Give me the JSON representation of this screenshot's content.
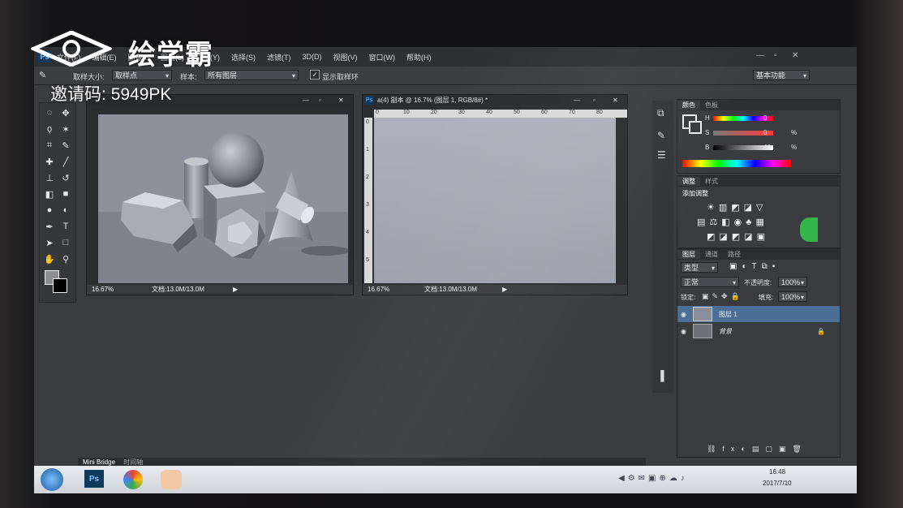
{
  "watermark": {
    "brand": "绘学霸",
    "invite_label": "邀请码:",
    "invite_code": "5949PK"
  },
  "menubar": {
    "app_icon": "Ps",
    "items": [
      "文件(F)",
      "编辑(E)",
      "图像(I)",
      "图层(L)",
      "文字(Y)",
      "选择(S)",
      "滤镜(T)",
      "3D(D)",
      "视图(V)",
      "窗口(W)",
      "帮助(H)"
    ],
    "window_controls": [
      "—",
      "▫",
      "✕"
    ]
  },
  "options_bar": {
    "sample_size_label": "取样大小:",
    "sample_size_value": "取样点",
    "sample_label": "样本:",
    "sample_value": "所有图层",
    "show_ring_label": "显示取样环",
    "show_ring_checked": true,
    "workspace_value": "基本功能"
  },
  "doc1": {
    "zoom": "16.67%",
    "doc_size": "文档:13.0M/13.0M",
    "controls": [
      "—",
      "▫",
      "✕"
    ]
  },
  "doc2": {
    "title": "a(4) 副本 @ 16.7% (图层 1, RGB/8#) *",
    "zoom": "16.67%",
    "doc_size": "文档:13.0M/13.0M",
    "ruler_h": [
      "0",
      "10",
      "20",
      "30",
      "40",
      "50",
      "60",
      "70",
      "80"
    ],
    "ruler_v": [
      "0",
      "1",
      "2",
      "3",
      "4",
      "5"
    ],
    "controls": [
      "—",
      "▫",
      "✕"
    ]
  },
  "color_panel": {
    "tabs": [
      "颜色",
      "色板"
    ],
    "rows": [
      {
        "label": "H",
        "value": "0",
        "unit": "",
        "fraction": 0.0
      },
      {
        "label": "S",
        "value": "0",
        "unit": "%",
        "fraction": 0.0
      },
      {
        "label": "B",
        "value": "46",
        "unit": "%",
        "fraction": 0.46
      }
    ]
  },
  "adjustments_panel": {
    "tabs": [
      "调整",
      "样式"
    ],
    "heading": "添加调整"
  },
  "layers_panel": {
    "tabs": [
      "图层",
      "通道",
      "路径"
    ],
    "filter_value": "类型",
    "blend_mode": "正常",
    "opacity_label": "不透明度:",
    "opacity_value": "100%",
    "lock_label": "锁定:",
    "fill_label": "填充:",
    "fill_value": "100%",
    "layers": [
      {
        "name": "图层 1",
        "selected": true
      },
      {
        "name": "背景",
        "selected": false,
        "locked": true
      }
    ]
  },
  "bottom_tabs": [
    "Mini Bridge",
    "时间轴"
  ],
  "taskbar": {
    "time": "16:48",
    "date": "2017/7/10",
    "ps_label": "Ps"
  },
  "colors": {
    "accent": "#2f6ea8",
    "panel_bg": "#3a3b3f",
    "workspace_bg": "#3b3c40"
  }
}
